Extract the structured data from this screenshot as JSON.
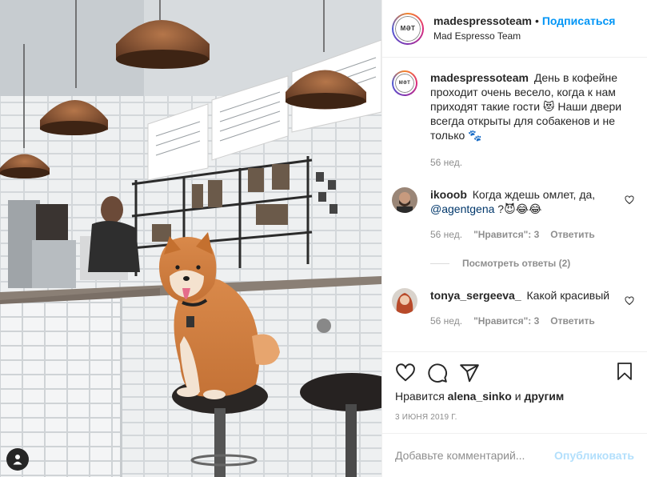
{
  "header": {
    "username": "madespressoteam",
    "dot": "•",
    "follow_label": "Подписаться",
    "full_name": "Mad Espresso Team",
    "logo_text": "MӘT"
  },
  "caption": {
    "username": "madespressoteam",
    "text": "День в кофейне проходит очень весело, когда к нам приходят такие гости 😻 Наши двери всегда открыты для собакенов и не только 🐾",
    "time": "56 нед."
  },
  "comments": [
    {
      "username": "ikooob",
      "text_before": "Когда ждешь омлет, да,",
      "mention": "@agentgena",
      "text_after": "?😈😂😂",
      "time": "56 нед.",
      "likes": "\"Нравится\": 3",
      "reply": "Ответить"
    },
    {
      "username": "tonya_sergeeva_",
      "text": "Какой красивый",
      "time": "56 нед.",
      "likes": "\"Нравится\": 3",
      "reply": "Ответить"
    }
  ],
  "view_replies": "Посмотреть ответы (2)",
  "likes": {
    "prefix": "Нравится",
    "user": "alena_sinko",
    "joiner": "и",
    "others": "другим"
  },
  "date": "3 ИЮНЯ 2019 Г.",
  "add_comment": {
    "placeholder": "Добавьте комментарий...",
    "publish_label": "Опубликовать"
  },
  "icons": [
    "user-tag-icon",
    "heart-icon",
    "comment-icon",
    "share-icon",
    "bookmark-icon",
    "heart-small-icon"
  ],
  "colors": {
    "accent": "#0095f6",
    "publish_disabled": "#b2dffc",
    "muted": "#8e8e8e",
    "mention": "#00376b"
  }
}
